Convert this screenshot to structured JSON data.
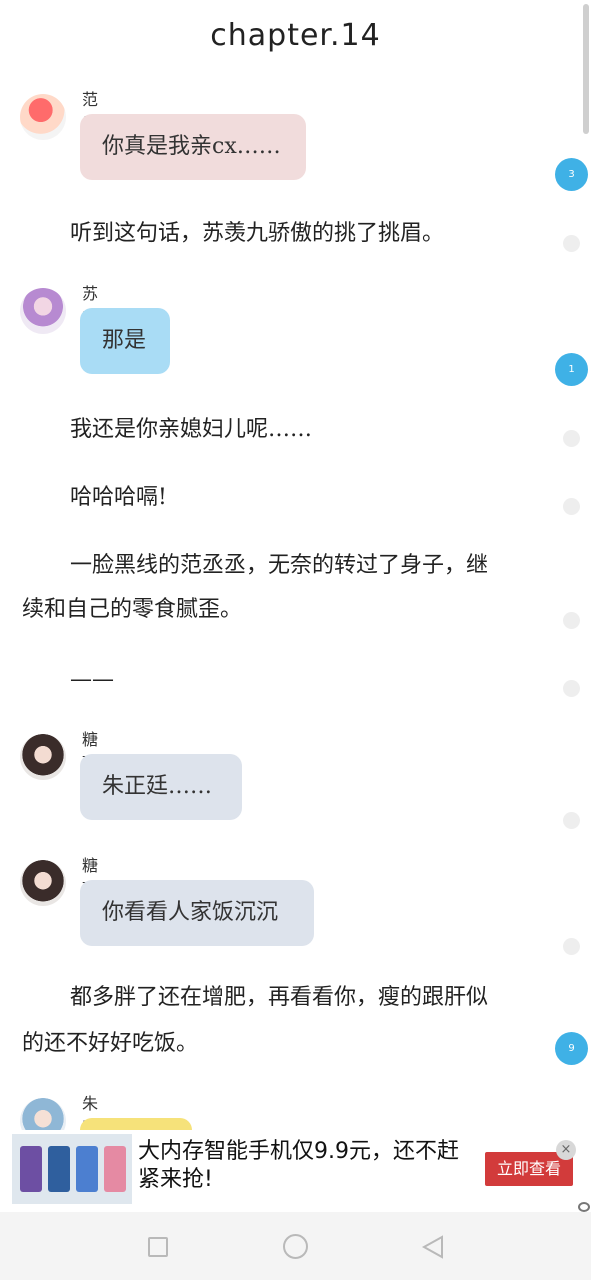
{
  "chapter": {
    "title": "chapter.14"
  },
  "messages": [
    {
      "sender": "范丞丞",
      "text": "你真是我亲cx……"
    },
    {
      "sender": "苏羡九",
      "text": "那是"
    },
    {
      "sender": "糖酥",
      "text": "朱正廷……"
    },
    {
      "sender": "糖酥",
      "text": "你看看人家饭沉沉"
    },
    {
      "sender": "朱正廷",
      "text": ""
    }
  ],
  "narration": [
    "听到这句话，苏羡九骄傲的挑了挑眉。",
    "我还是你亲媳妇儿呢……",
    "哈哈哈嗝!",
    "一脸黑线的范丞丞，无奈的转过了身子，继",
    "续和自己的零食腻歪。",
    "——",
    "都多胖了还在增肥，再看看你，瘦的跟肝似",
    "的还不好好吃饭。"
  ],
  "comment_counts": [
    "3",
    "1",
    "9"
  ],
  "ad": {
    "text": "大内存智能手机仅9.9元，还不赶紧来抢!",
    "button_label": "立即查看",
    "close_label": "×"
  },
  "colors": {
    "bubble_pink": "#f1dcdc",
    "bubble_blue": "#a9dcf5",
    "bubble_gray": "#dde3ec",
    "bubble_yellow": "#f6e27a",
    "badge_blue": "#3fb1e6",
    "ad_button_red": "#d23b3b"
  },
  "icons": {
    "nav": [
      "recent-apps-square-icon",
      "home-circle-icon",
      "back-triangle-icon"
    ],
    "ad_privacy": "eye-icon"
  }
}
